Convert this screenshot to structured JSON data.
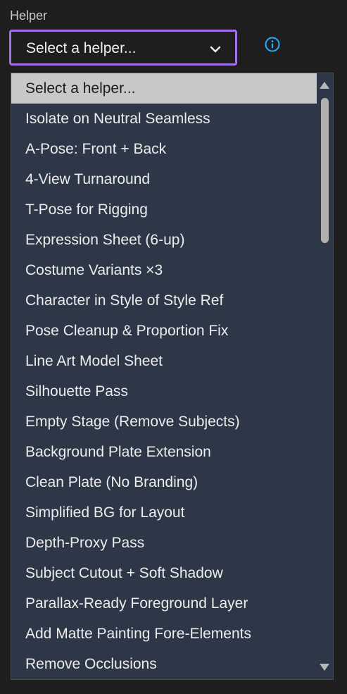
{
  "field": {
    "label": "Helper"
  },
  "select": {
    "value": "Select a helper...",
    "accent_color": "#a472e8"
  },
  "info": {
    "icon": "info-icon",
    "color": "#22b0ff"
  },
  "options": [
    {
      "label": "Select a helper...",
      "selected": true
    },
    {
      "label": "Isolate on Neutral Seamless"
    },
    {
      "label": "A-Pose: Front + Back"
    },
    {
      "label": "4-View Turnaround"
    },
    {
      "label": "T-Pose for Rigging"
    },
    {
      "label": "Expression Sheet (6-up)"
    },
    {
      "label": "Costume Variants ×3"
    },
    {
      "label": "Character in Style of Style Ref"
    },
    {
      "label": "Pose Cleanup & Proportion Fix"
    },
    {
      "label": "Line Art Model Sheet"
    },
    {
      "label": "Silhouette Pass"
    },
    {
      "label": "Empty Stage (Remove Subjects)"
    },
    {
      "label": "Background Plate Extension"
    },
    {
      "label": "Clean Plate (No Branding)"
    },
    {
      "label": "Simplified BG for Layout"
    },
    {
      "label": "Depth-Proxy Pass"
    },
    {
      "label": "Subject Cutout + Soft Shadow"
    },
    {
      "label": "Parallax-Ready Foreground Layer"
    },
    {
      "label": "Add Matte Painting Fore-Elements"
    },
    {
      "label": "Remove Occlusions"
    }
  ]
}
